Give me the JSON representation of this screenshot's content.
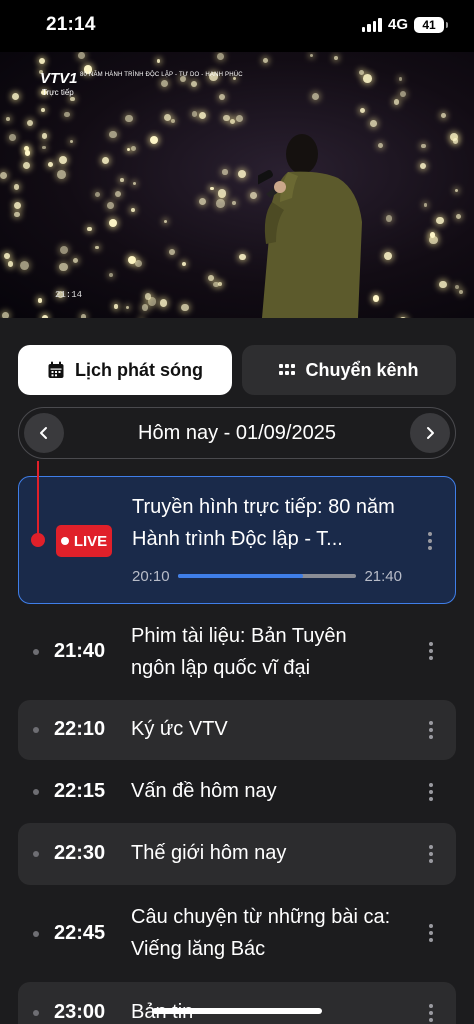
{
  "status_bar": {
    "time": "21:14",
    "network": "4G",
    "battery": "41"
  },
  "video": {
    "channel_logo": "VTV1",
    "live_label": "Trực tiếp",
    "banner": "80 NĂM HÀNH TRÌNH ĐỘC LẬP - TỰ DO - HẠNH PHÚC",
    "timecode": "21:14"
  },
  "tabs": [
    {
      "label": "Lịch phát sóng",
      "icon": "calendar-icon",
      "active": true
    },
    {
      "label": "Chuyển kênh",
      "icon": "grid-icon",
      "active": false
    }
  ],
  "date_nav": {
    "label": "Hôm nay - 01/09/2025"
  },
  "live_program": {
    "badge": "LIVE",
    "title": "Truyền hình trực tiếp: 80 năm Hành trình Độc lập - T...",
    "start": "20:10",
    "end": "21:40",
    "progress": 0.7
  },
  "schedule": [
    {
      "time": "21:40",
      "title": "Phim tài liệu: Bản Tuyên ngôn lập quốc vĩ đại"
    },
    {
      "time": "22:10",
      "title": "Ký ức VTV"
    },
    {
      "time": "22:15",
      "title": "Vấn đề hôm nay"
    },
    {
      "time": "22:30",
      "title": "Thế giới hôm nay"
    },
    {
      "time": "22:45",
      "title": "Câu chuyện từ những bài ca: Viếng lăng Bác"
    },
    {
      "time": "23:00",
      "title": "Bản tin"
    }
  ],
  "colors": {
    "accent_blue": "#3f7ee8",
    "live_red": "#e0202a",
    "panel_bg": "#1c1c1e"
  }
}
